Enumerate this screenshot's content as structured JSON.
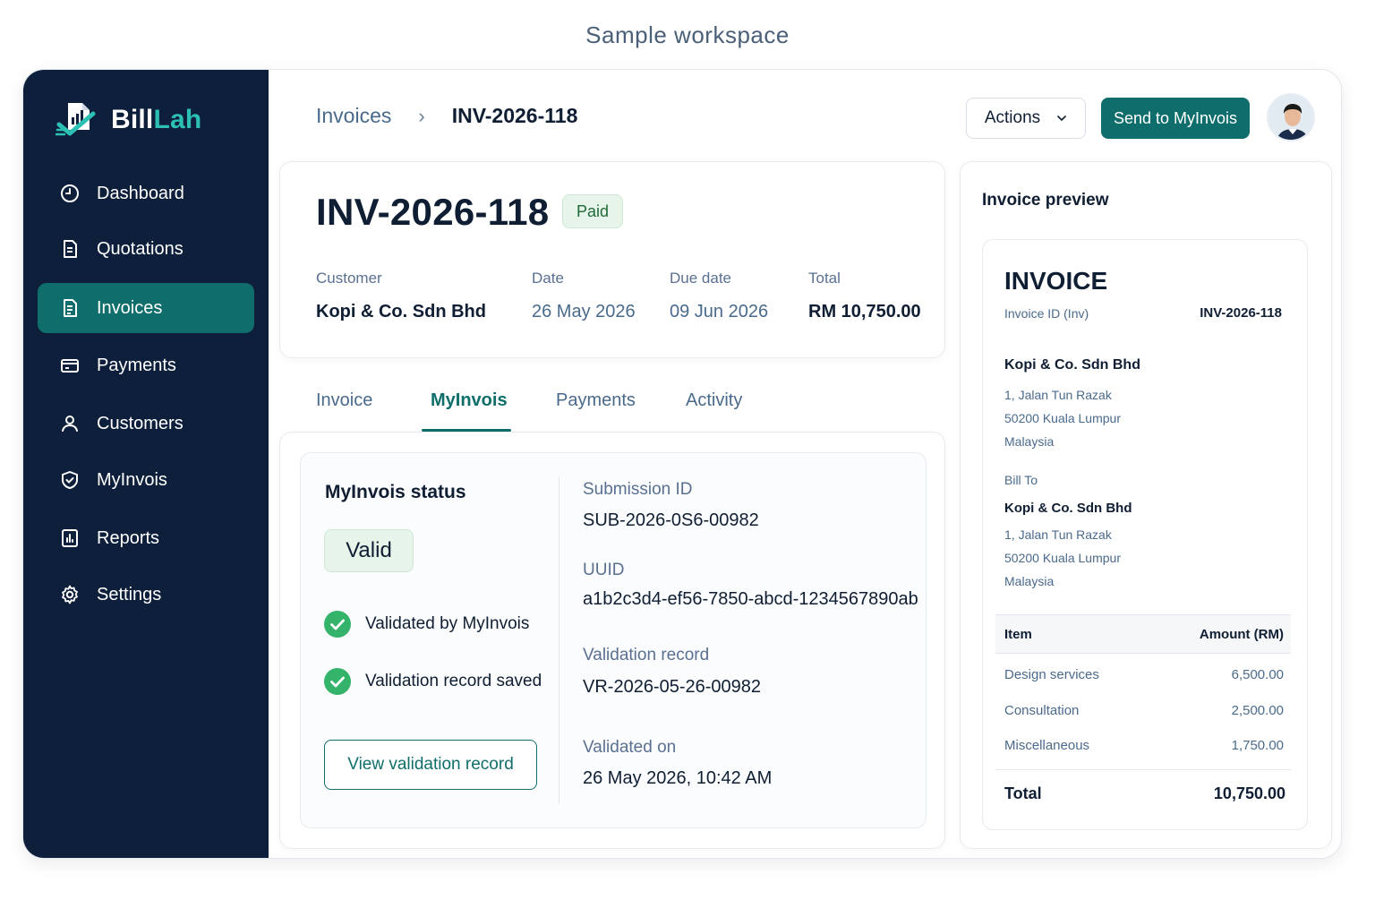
{
  "caption": "Sample workspace",
  "brand": {
    "name_part1": "Bill",
    "name_part2": "Lah",
    "accent": "#2cc0b4"
  },
  "colors": {
    "sidebar_bg": "#0d1f3a",
    "primary": "#0f6e6b",
    "success": "#34b36b",
    "badge_bg": "#e6f4e9"
  },
  "sidebar": {
    "items": [
      {
        "label": "Dashboard",
        "icon": "dashboard-icon"
      },
      {
        "label": "Quotations",
        "icon": "document-icon"
      },
      {
        "label": "Invoices",
        "icon": "invoice-icon",
        "active": true
      },
      {
        "label": "Payments",
        "icon": "credit-card-icon"
      },
      {
        "label": "Customers",
        "icon": "users-icon"
      },
      {
        "label": "MyInvois",
        "icon": "shield-check-icon"
      },
      {
        "label": "Reports",
        "icon": "bar-chart-icon"
      },
      {
        "label": "Settings",
        "icon": "gear-icon"
      }
    ]
  },
  "header": {
    "breadcrumb_parent": "Invoices",
    "breadcrumb_current": "INV-2026-118",
    "actions_label": "Actions",
    "send_label": "Send to MyInvois"
  },
  "summary": {
    "invoice_number": "INV-2026-118",
    "status": "Paid",
    "customer_label": "Customer",
    "customer_value": "Kopi & Co. Sdn Bhd",
    "date_label": "Date",
    "date_value": "26 May 2026",
    "due_label": "Due date",
    "due_value": "09 Jun 2026",
    "total_label": "Total",
    "total_value": "RM 10,750.00"
  },
  "tabs": [
    {
      "label": "Invoice"
    },
    {
      "label": "MyInvois",
      "active": true
    },
    {
      "label": "Payments"
    },
    {
      "label": "Activity"
    }
  ],
  "myinvois": {
    "title": "MyInvois status",
    "status": "Valid",
    "check1": "Validated by MyInvois",
    "check2": "Validation record saved",
    "view_button": "View validation record",
    "submission_label": "Submission ID",
    "submission_value": "SUB-2026-0S6-00982",
    "uuid_label": "UUID",
    "uuid_value": "a1b2c3d4-ef56-7850-abcd-1234567890ab",
    "record_label": "Validation record",
    "record_value": "VR-2026-05-26-00982",
    "validated_label": "Validated on",
    "validated_value": "26 May 2026, 10:42 AM"
  },
  "preview": {
    "title": "Invoice preview",
    "heading": "INVOICE",
    "id_label": "Invoice ID (Inv)",
    "id_value": "INV-2026-118",
    "from_name": "Kopi & Co. Sdn Bhd",
    "from_addr1": "1, Jalan Tun Razak",
    "from_addr2": "50200 Kuala Lumpur",
    "from_addr3": "Malaysia",
    "billto_label": "Bill To",
    "to_name": "Kopi & Co. Sdn Bhd",
    "to_addr1": "1, Jalan Tun Razak",
    "to_addr2": "50200 Kuala Lumpur",
    "to_addr3": "Malaysia",
    "col_item": "Item",
    "col_amount": "Amount (RM)",
    "items": [
      {
        "name": "Design services",
        "amount": "6,500.00"
      },
      {
        "name": "Consultation",
        "amount": "2,500.00"
      },
      {
        "name": "Miscellaneous",
        "amount": "1,750.00"
      }
    ],
    "total_label": "Total",
    "total_value": "10,750.00"
  }
}
